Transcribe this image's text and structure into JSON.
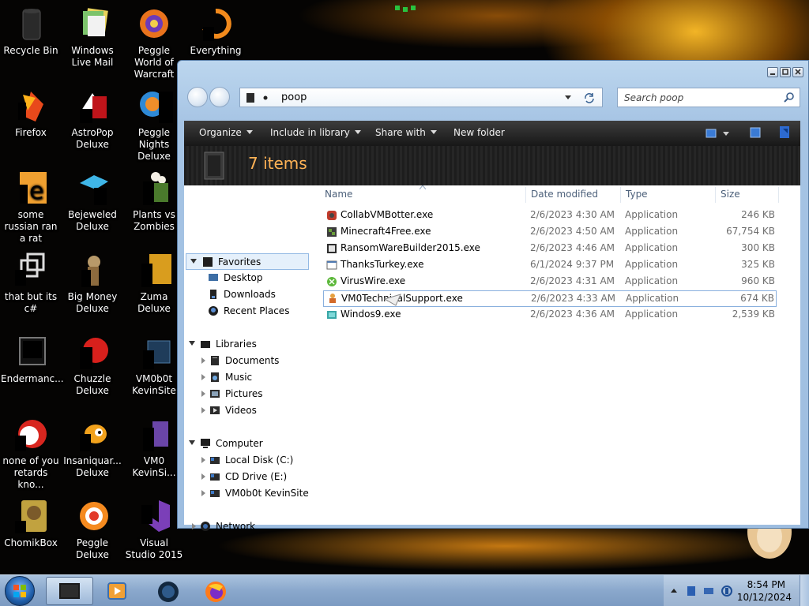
{
  "desktop": {
    "icons": [
      {
        "label": "Recycle Bin"
      },
      {
        "label": "Windows Live Mail"
      },
      {
        "label": "Peggle World of Warcraft"
      },
      {
        "label": "Everything"
      },
      {
        "label": "Firefox"
      },
      {
        "label": "AstroPop Deluxe"
      },
      {
        "label": "Peggle Nights Deluxe"
      },
      {
        "label": "some russian ran a rat"
      },
      {
        "label": "Bejeweled Deluxe"
      },
      {
        "label": "Plants vs Zombies"
      },
      {
        "label": "that but its c#"
      },
      {
        "label": "Big Money Deluxe"
      },
      {
        "label": "Zuma Deluxe"
      },
      {
        "label": "Endermanc..."
      },
      {
        "label": "Chuzzle Deluxe"
      },
      {
        "label": "VM0b0t KevinSite"
      },
      {
        "label": "none of you retards kno..."
      },
      {
        "label": "Insaniquar... Deluxe"
      },
      {
        "label": "VM0 KevinSi..."
      },
      {
        "label": "ChomikBox"
      },
      {
        "label": "Peggle Deluxe"
      },
      {
        "label": "Visual Studio 2015"
      }
    ]
  },
  "window": {
    "address": {
      "segment": "poop"
    },
    "search": {
      "placeholder": "Search poop"
    },
    "toolbar": {
      "organize": "Organize",
      "include": "Include in library",
      "share": "Share with",
      "new_folder": "New folder"
    },
    "item_count": "7 items",
    "nav": {
      "favorites": "Favorites",
      "desktop": "Desktop",
      "downloads": "Downloads",
      "recent": "Recent Places",
      "libraries": "Libraries",
      "documents": "Documents",
      "music": "Music",
      "pictures": "Pictures",
      "videos": "Videos",
      "computer": "Computer",
      "local_disk": "Local Disk (C:)",
      "cd_drive": "CD Drive (E:)",
      "vm_drive": "VM0b0t KevinSite",
      "network": "Network"
    },
    "columns": {
      "name": "Name",
      "date": "Date modified",
      "type": "Type",
      "size": "Size"
    },
    "files": [
      {
        "name": "CollabVMBotter.exe",
        "date": "2/6/2023 4:30 AM",
        "type": "Application",
        "size": "246 KB"
      },
      {
        "name": "Minecraft4Free.exe",
        "date": "2/6/2023 4:50 AM",
        "type": "Application",
        "size": "67,754 KB"
      },
      {
        "name": "RansomWareBuilder2015.exe",
        "date": "2/6/2023 4:46 AM",
        "type": "Application",
        "size": "300 KB"
      },
      {
        "name": "ThanksTurkey.exe",
        "date": "6/1/2024 9:37 PM",
        "type": "Application",
        "size": "325 KB"
      },
      {
        "name": "VirusWire.exe",
        "date": "2/6/2023 4:31 AM",
        "type": "Application",
        "size": "960 KB"
      },
      {
        "name": "VM0TechnicalSupport.exe",
        "date": "2/6/2023 4:33 AM",
        "type": "Application",
        "size": "674 KB"
      },
      {
        "name": "Windos9.exe",
        "date": "2/6/2023 4:36 AM",
        "type": "Application",
        "size": "2,539 KB"
      }
    ]
  },
  "taskbar": {
    "time": "8:54 PM",
    "date": "10/12/2024"
  }
}
